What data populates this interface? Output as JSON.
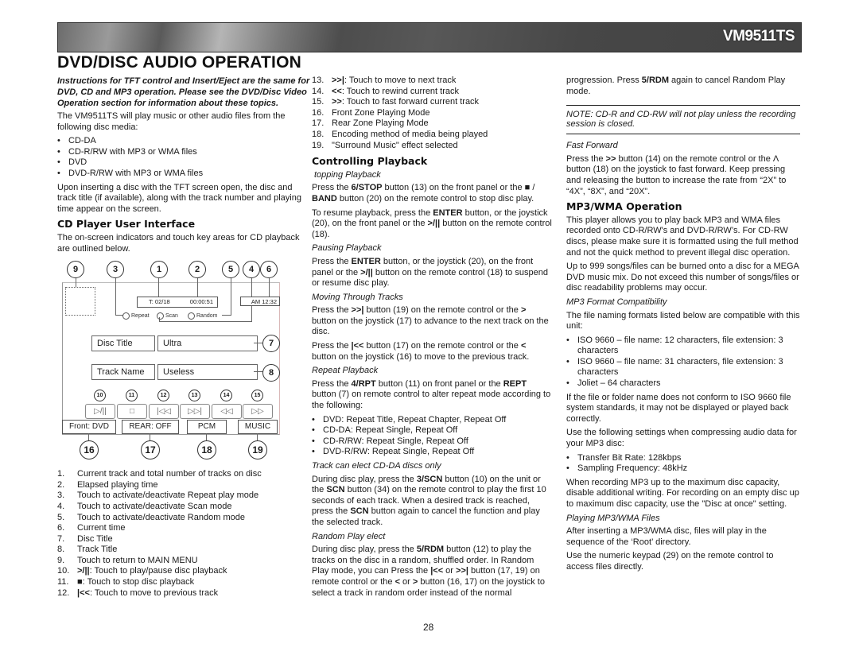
{
  "header": {
    "model": "VM9511TS",
    "title": "DVD/DISC AUDIO OPERATION"
  },
  "col1": {
    "intro": "Instructions for TFT control and Insert/Eject are the same for DVD, CD and MP3 operation. Please see the DVD/Disc Video Operation section for information about these topics.",
    "p1": "The VM9511TS will play music or other audio files from the following disc media:",
    "media": [
      "CD-DA",
      "CD-R/RW with MP3 or WMA files",
      "DVD",
      "DVD-R/RW with MP3 or WMA files"
    ],
    "p2": "Upon inserting a disc with the TFT screen open, the disc and track title (if available), along with the track number and playing time appear on the screen.",
    "h_ui": "CD Player User Interface",
    "p3": "The on-screen indicators and touch key areas for CD playback are outlined below.",
    "legend": [
      {
        "n": "1.",
        "t": "Current track and total number of tracks on disc"
      },
      {
        "n": "2.",
        "t": "Elapsed playing time"
      },
      {
        "n": "3.",
        "t": "Touch to activate/deactivate Repeat play mode"
      },
      {
        "n": "4.",
        "t": "Touch to activate/deactivate Scan mode"
      },
      {
        "n": "5.",
        "t": "Touch to activate/deactivate Random mode"
      },
      {
        "n": "6.",
        "t": "Current time"
      },
      {
        "n": "7.",
        "t": "Disc Title"
      },
      {
        "n": "8.",
        "t": "Track Title"
      },
      {
        "n": "9.",
        "t": "Touch to return to MAIN MENU"
      },
      {
        "n": "10.",
        "k": ">/||",
        "t": ": Touch to play/pause disc playback"
      },
      {
        "n": "11.",
        "k": "■",
        "t": ": Touch to stop disc playback"
      },
      {
        "n": "12.",
        "k": "|<<",
        "t": ": Touch to move to previous track"
      }
    ]
  },
  "diagram": {
    "callouts_top": [
      "9",
      "3",
      "1",
      "2",
      "5",
      "4",
      "6"
    ],
    "track": "T: 02/18",
    "elapsed": "00:00:51",
    "clock": "AM 12:32",
    "radios": [
      "Repeat",
      "Scan",
      "Random"
    ],
    "disc_label": "Disc Title",
    "disc_value": "Ultra",
    "track_label": "Track Name",
    "track_value": "Useless",
    "callout7": "7",
    "callout8": "8",
    "ctrl_callouts": [
      "10",
      "11",
      "12",
      "13",
      "14",
      "15"
    ],
    "ctrl_icons": [
      "▷/||",
      "□",
      "|◁◁",
      "▷▷|",
      "◁◁",
      "▷▷"
    ],
    "status": [
      "Front: DVD",
      "REAR: OFF",
      "PCM",
      "MUSIC"
    ],
    "callouts_bottom": [
      "16",
      "17",
      "18",
      "19"
    ]
  },
  "col2": {
    "legend": [
      {
        "n": "13.",
        "k": ">>|",
        "t": ": Touch to move to next track"
      },
      {
        "n": "14.",
        "k": "<<",
        "t": ": Touch to rewind current track"
      },
      {
        "n": "15.",
        "k": ">>",
        "t": ": Touch to fast forward current track"
      },
      {
        "n": "16.",
        "t": "Front Zone Playing Mode"
      },
      {
        "n": "17.",
        "t": "Rear Zone Playing Mode"
      },
      {
        "n": "18.",
        "t": "Encoding method of media being played"
      },
      {
        "n": "19.",
        "t": "\"Surround Music\" effect selected"
      }
    ],
    "h_ctrl": "Controlling Playback",
    "s_stop": "topping Playback",
    "stop_a": "Press the ",
    "stop_b": "6/STOP",
    "stop_c": " button (13) on the front panel or the ■ / ",
    "stop_d": "BAND",
    "stop_e": " button (20) on the remote control to stop disc play.",
    "resume_a": "To resume playback, press the ",
    "resume_b": "ENTER",
    "resume_c": " button, or the joystick (20), on the front panel or the ",
    "resume_d": ">/||",
    "resume_e": " button on the remote control (18).",
    "s_pause": "Pausing Playback",
    "pause_a": "Press the ",
    "pause_b": "ENTER",
    "pause_c": " button, or the joystick (20), on the front panel or the ",
    "pause_d": ">/||",
    "pause_e": " button on the remote control (18) to suspend or resume disc play.",
    "s_move": "Moving Through Tracks",
    "next_a": "Press the ",
    "next_b": ">>|",
    "next_c": " button (19) on the remote control or the ",
    "next_d": ">",
    "next_e": " button on the joystick (17) to advance to the next track on the disc.",
    "prev_a": "Press the ",
    "prev_b": "|<<",
    "prev_c": " button (17) on the remote control or the ",
    "prev_d": "<",
    "prev_e": " button on the joystick (16) to move to the previous track.",
    "s_repeat": "Repeat Playback",
    "rpt_a": "Press the ",
    "rpt_b": "4/RPT",
    "rpt_c": " button (11) on front panel or the ",
    "rpt_d": "REPT",
    "rpt_e": " button (7) on remote control to alter repeat mode according to the following:",
    "repeat_modes": [
      "DVD: Repeat Title, Repeat Chapter, Repeat Off",
      "CD-DA: Repeat Single, Repeat Off",
      "CD-R/RW: Repeat Single, Repeat Off",
      "DVD-R/RW: Repeat Single, Repeat Off"
    ],
    "s_scan": "Track  can  elect  CD-DA discs only",
    "scan_a": "During disc play, press the ",
    "scan_b": "3/SCN",
    "scan_c": " button (10) on the unit or the ",
    "scan_d": "SCN",
    "scan_e": " button (34) on the remote control to play the first 10 seconds of each track. When a desired track is reached, press the ",
    "scan_f": "SCN",
    "scan_g": " button again to cancel the function and play the selected track.",
    "s_random": "Random Play  elect",
    "rdm_a": "During disc play, press the ",
    "rdm_b": "5/RDM",
    "rdm_c": " button (12) to play the tracks on the disc in a random, shuffled order. In Random Play mode, you can Press the ",
    "rdm_d": "|<<",
    "rdm_e": " or ",
    "rdm_f": ">>|",
    "rdm_g": " button (17, 19) on remote control or the ",
    "rdm_h": "<",
    "rdm_i": " or ",
    "rdm_j": ">",
    "rdm_k": " button (16, 17) on the joystick to select a track in random order instead of the normal"
  },
  "col3": {
    "cont_a": "progression. Press ",
    "cont_b": "5/RDM",
    "cont_c": " again to cancel Random Play mode.",
    "note": "NOTE: CD-R and CD-RW will not play unless the recording session is closed.",
    "s_ff": "Fast Forward",
    "ff_a": "Press the ",
    "ff_b": ">>",
    "ff_c": " button (14) on the remote control or the Λ button (18) on the joystick to fast forward. Keep pressing and releasing the button to increase the rate from “2X” to “4X”, “8X”, and “20X”.",
    "h_mp3": "MP3/WMA Operation",
    "mp3_p1": "This player allows you to play back MP3 and WMA files recorded onto CD-R/RW's and DVD-R/RW’s. For CD-RW discs, please make sure it is formatted using the full method and not the quick method to prevent illegal disc operation.",
    "mp3_p2": "Up to 999 songs/files can be burned onto a disc for a MEGA DVD music mix. Do not exceed this number of songs/files or disc readability problems may occur.",
    "s_compat": "MP3 Format Compatibility",
    "compat_p": "The file naming formats listed below are compatible with this unit:",
    "formats": [
      "ISO 9660 – file name: 12 characters, file extension: 3 characters",
      "ISO 9660 – file name: 31 characters, file extension: 3 characters",
      "Joliet – 64 characters"
    ],
    "conform_p": "If the file or folder name does not conform to ISO 9660 file system standards, it may not be displayed or played back correctly.",
    "settings_p": "Use the following settings when compressing audio data for your MP3 disc:",
    "settings": [
      "Transfer Bit Rate: 128kbps",
      "Sampling Frequency: 48kHz"
    ],
    "max_p": "When recording MP3 up to the maximum disc capacity, disable additional writing. For recording on an empty disc up to maximum disc capacity, use the \"Disc at once\" setting.",
    "s_play": "Playing MP3/WMA Files",
    "play_p1": "After inserting a MP3/WMA disc, files will play in the sequence of the ‘Root’ directory.",
    "play_p2": "Use the numeric keypad (29) on the remote control to access files directly."
  },
  "footer": {
    "page": "28"
  }
}
